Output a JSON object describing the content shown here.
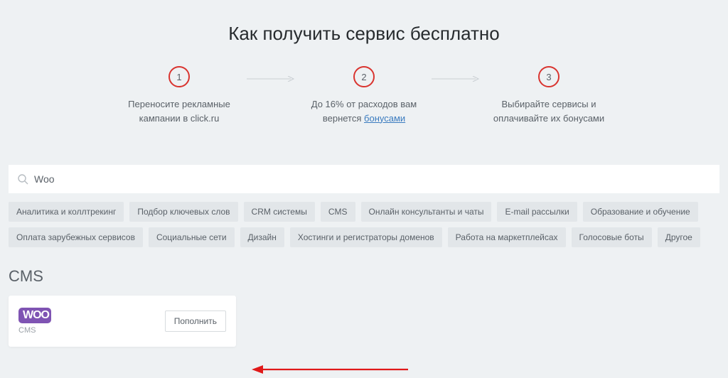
{
  "title": "Как получить сервис бесплатно",
  "steps": [
    {
      "num": "1",
      "text_before": "Переносите рекламные кампании в click.ru",
      "link": ""
    },
    {
      "num": "2",
      "text_before": "До 16% от расходов вам вернется ",
      "link": "бонусами"
    },
    {
      "num": "3",
      "text_before": "Выбирайте сервисы и оплачивайте их бонусами",
      "link": ""
    }
  ],
  "search": {
    "value": "Woo"
  },
  "tags": [
    "Аналитика и коллтрекинг",
    "Подбор ключевых слов",
    "CRM системы",
    "CMS",
    "Онлайн консультанты и чаты",
    "E-mail рассылки",
    "Образование и обучение",
    "Оплата зарубежных сервисов",
    "Социальные сети",
    "Дизайн",
    "Хостинги и регистраторы доменов",
    "Работа на маркетплейсах",
    "Голосовые боты",
    "Другое"
  ],
  "section": "CMS",
  "card": {
    "logo": "WOO",
    "category": "CMS",
    "button": "Пополнить"
  }
}
